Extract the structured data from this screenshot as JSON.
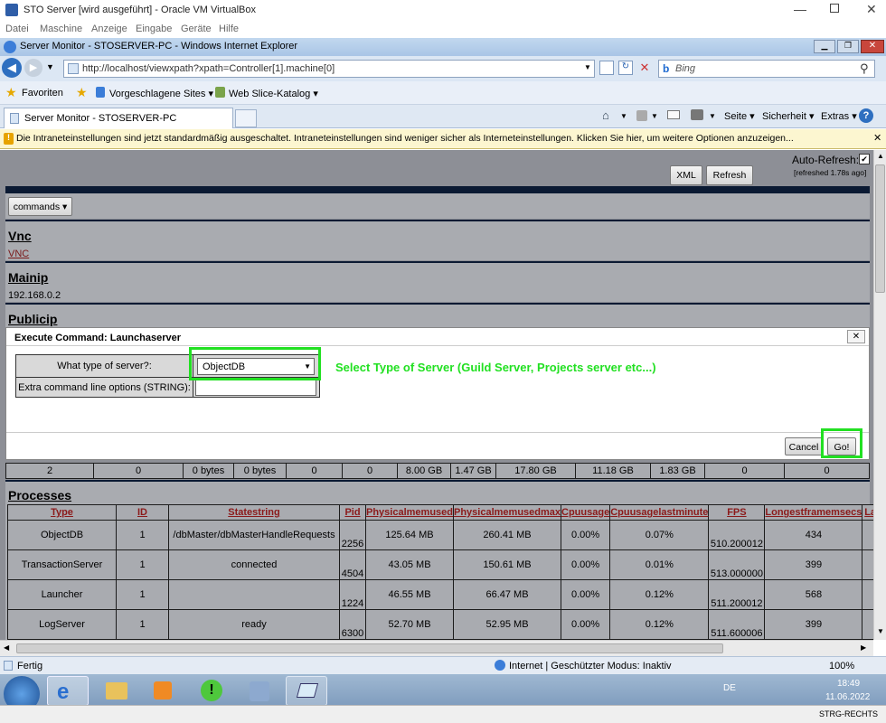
{
  "vbox": {
    "title": "STO Server [wird ausgeführt] - Oracle VM VirtualBox",
    "menu": [
      "Datei",
      "Maschine",
      "Anzeige",
      "Eingabe",
      "Geräte",
      "Hilfe"
    ]
  },
  "ie": {
    "title": "Server Monitor - STOSERVER-PC - Windows Internet Explorer",
    "url": "http://localhost/viewxpath?xpath=Controller[1].machine[0]",
    "search_placeholder": "Bing",
    "favorites_label": "Favoriten",
    "fav_items": [
      "Vorgeschlagene Sites ▾",
      "Web Slice-Katalog ▾"
    ],
    "tab_label": "Server Monitor - STOSERVER-PC",
    "cmd_items": [
      "Seite ▾",
      "Sicherheit ▾",
      "Extras ▾"
    ],
    "infobar": "Die Intraneteinstellungen sind jetzt standardmäßig ausgeschaltet. Intraneteinstellungen sind weniger sicher als Interneteinstellungen. Klicken Sie hier, um weitere Optionen anzuzeigen...",
    "status_left": "Fertig",
    "status_mid": "Internet | Geschützter Modus: Inaktiv",
    "zoom": "100%"
  },
  "page": {
    "auto_refresh_label": "Auto-Refresh:",
    "refreshed_text": "[refreshed 1.78s ago]",
    "xml_button": "XML",
    "refresh_button": "Refresh",
    "commands_button": "commands ▾",
    "vnc_heading": "Vnc",
    "vnc_link": "VNC",
    "mainip_heading": "Mainip",
    "mainip_value": "192.168.0.2",
    "publicip_heading": "Publicip",
    "processes_heading": "Processes"
  },
  "dialog": {
    "title": "Execute Command: Launchaserver",
    "close": "✕",
    "server_type_label": "What type of server?:",
    "server_type_value": "ObjectDB",
    "extra_label": "Extra command line options (STRING):",
    "extra_value": "",
    "annotation": "Select Type of Server (Guild Server, Projects server etc...)",
    "cancel_button": "Cancel",
    "go_button": "Go!"
  },
  "summary_row": [
    "2",
    "0",
    "0 bytes",
    "0 bytes",
    "0",
    "0",
    "8.00 GB",
    "1.47 GB",
    "17.80 GB",
    "11.18 GB",
    "1.83 GB",
    "0",
    "0"
  ],
  "processes": {
    "columns": [
      "Type",
      "ID",
      "Statestring",
      "Pid",
      "Physicalmemused",
      "Physicalmemusedmax",
      "Cpuusage",
      "Cpuusagelastminute",
      "FPS",
      "Longestframemsecs",
      "Las"
    ],
    "rows": [
      [
        "ObjectDB",
        "1",
        "/dbMaster/dbMasterHandleRequests",
        "2256",
        "125.64 MB",
        "260.41 MB",
        "0.00%",
        "0.07%",
        "510.200012",
        "434",
        ""
      ],
      [
        "TransactionServer",
        "1",
        "connected",
        "4504",
        "43.05 MB",
        "150.61 MB",
        "0.00%",
        "0.01%",
        "513.000000",
        "399",
        ""
      ],
      [
        "Launcher",
        "1",
        "",
        "1224",
        "46.55 MB",
        "66.47 MB",
        "0.00%",
        "0.12%",
        "511.200012",
        "568",
        ""
      ],
      [
        "LogServer",
        "1",
        "ready",
        "6300",
        "52.70 MB",
        "52.95 MB",
        "0.00%",
        "0.12%",
        "511.600006",
        "399",
        ""
      ]
    ]
  },
  "taskbar": {
    "lang": "DE",
    "time": "18:49",
    "date": "11.06.2022",
    "host_key": "STRG-RECHTS"
  }
}
